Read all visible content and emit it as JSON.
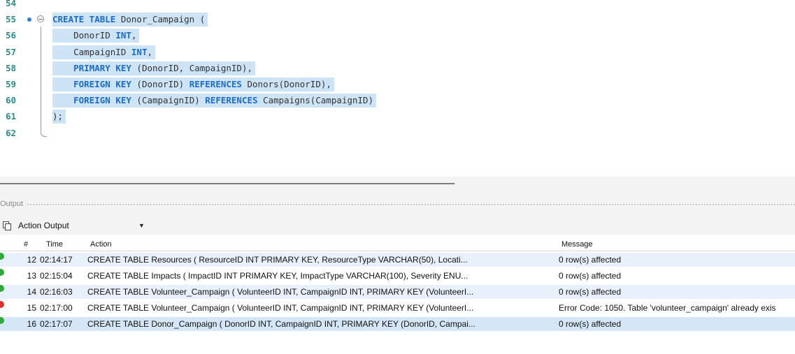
{
  "editor": {
    "lines": [
      {
        "num": "54",
        "tokens": []
      },
      {
        "num": "55",
        "tokens": [
          {
            "t": "CREATE TABLE",
            "k": 1
          },
          {
            "t": " Donor_Campaign (",
            "k": 0
          }
        ]
      },
      {
        "num": "56",
        "tokens": [
          {
            "t": "    DonorID ",
            "k": 0
          },
          {
            "t": "INT",
            "k": 1
          },
          {
            "t": ",",
            "k": 0
          }
        ]
      },
      {
        "num": "57",
        "tokens": [
          {
            "t": "    CampaignID ",
            "k": 0
          },
          {
            "t": "INT",
            "k": 1
          },
          {
            "t": ",",
            "k": 0
          }
        ]
      },
      {
        "num": "58",
        "tokens": [
          {
            "t": "    ",
            "k": 0
          },
          {
            "t": "PRIMARY KEY",
            "k": 1
          },
          {
            "t": " (DonorID, CampaignID),",
            "k": 0
          }
        ]
      },
      {
        "num": "59",
        "tokens": [
          {
            "t": "    ",
            "k": 0
          },
          {
            "t": "FOREIGN KEY",
            "k": 1
          },
          {
            "t": " (DonorID) ",
            "k": 0
          },
          {
            "t": "REFERENCES",
            "k": 1
          },
          {
            "t": " Donors(DonorID),",
            "k": 0
          }
        ]
      },
      {
        "num": "60",
        "tokens": [
          {
            "t": "    ",
            "k": 0
          },
          {
            "t": "FOREIGN KEY",
            "k": 1
          },
          {
            "t": " (CampaignID) ",
            "k": 0
          },
          {
            "t": "REFERENCES",
            "k": 1
          },
          {
            "t": " Campaigns(CampaignID)",
            "k": 0
          }
        ]
      },
      {
        "num": "61",
        "tokens": [
          {
            "t": ");",
            "k": 0
          }
        ]
      },
      {
        "num": "62",
        "tokens": []
      }
    ]
  },
  "output": {
    "title": "Output",
    "selector": "Action Output",
    "columns": {
      "num": "#",
      "time": "Time",
      "action": "Action",
      "message": "Message"
    },
    "rows": [
      {
        "status": "ok",
        "num": "12",
        "time": "02:14:17",
        "action": "CREATE TABLE Resources (    ResourceID INT PRIMARY KEY,    ResourceType VARCHAR(50),    Locati...",
        "message": "0 row(s) affected"
      },
      {
        "status": "ok",
        "num": "13",
        "time": "02:15:04",
        "action": "CREATE TABLE Impacts (    ImpactID INT PRIMARY KEY,    ImpactType VARCHAR(100),    Severity ENU...",
        "message": "0 row(s) affected"
      },
      {
        "status": "ok",
        "num": "14",
        "time": "02:16:03",
        "action": "CREATE TABLE Volunteer_Campaign (    VolunteerID INT,    CampaignID INT,    PRIMARY KEY (VolunteerI...",
        "message": "0 row(s) affected"
      },
      {
        "status": "error",
        "num": "15",
        "time": "02:17:00",
        "action": "CREATE TABLE Volunteer_Campaign (    VolunteerID INT,    CampaignID INT,    PRIMARY KEY (VolunteerI...",
        "message": "Error Code: 1050. Table 'volunteer_campaign' already exis"
      },
      {
        "status": "ok",
        "num": "16",
        "time": "02:17:07",
        "action": "CREATE TABLE Donor_Campaign (    DonorID INT,    CampaignID INT,    PRIMARY KEY (DonorID, Campai...",
        "message": "0 row(s) affected"
      }
    ]
  },
  "colors": {
    "keyword": "#1b6bd1",
    "line_number": "#2e8b8b",
    "selection": "#cde4f7",
    "ok": "#2eaa3a",
    "error": "#d8322c"
  }
}
